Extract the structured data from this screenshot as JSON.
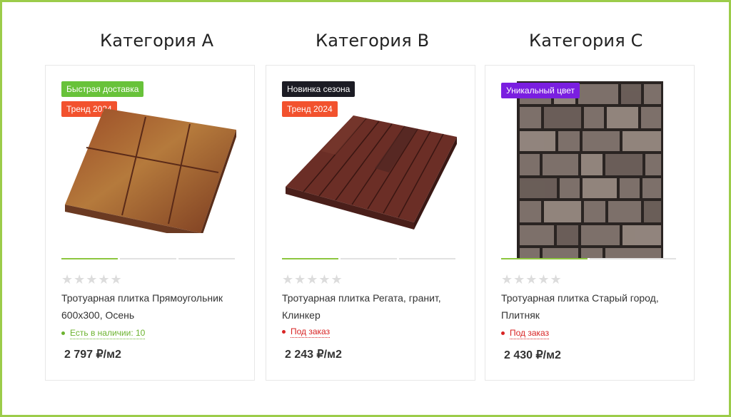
{
  "categories": [
    "Категория А",
    "Категория B",
    "Категория C"
  ],
  "products": [
    {
      "badges": [
        {
          "text": "Быстрая доставка",
          "color": "#68c23a"
        },
        {
          "text": "Тренд 2024",
          "color": "#f2522e"
        }
      ],
      "rating_stars": "★★★★★",
      "name": "Тротуарная плитка Прямоугольник 600х300, Осень",
      "stock": {
        "text": "Есть в наличии: 10",
        "color": "#6cb32f"
      },
      "price": "2 797 ₽/м2"
    },
    {
      "badges": [
        {
          "text": "Новинка сезона",
          "color": "#1c1c24"
        },
        {
          "text": "Тренд 2024",
          "color": "#f2522e"
        }
      ],
      "rating_stars": "★★★★★",
      "name": "Тротуарная плитка Регата, гранит, Клинкер",
      "stock": {
        "text": "Под заказ",
        "color": "#d82424"
      },
      "price": "2 243 ₽/м2"
    },
    {
      "badges": [
        {
          "text": "Уникальный цвет",
          "color": "#7a1ee0"
        }
      ],
      "rating_stars": "★★★★★",
      "name": "Тротуарная плитка Старый город, Плитняк",
      "stock": {
        "text": "Под заказ",
        "color": "#d82424"
      },
      "price": "2 430 ₽/м2"
    }
  ]
}
